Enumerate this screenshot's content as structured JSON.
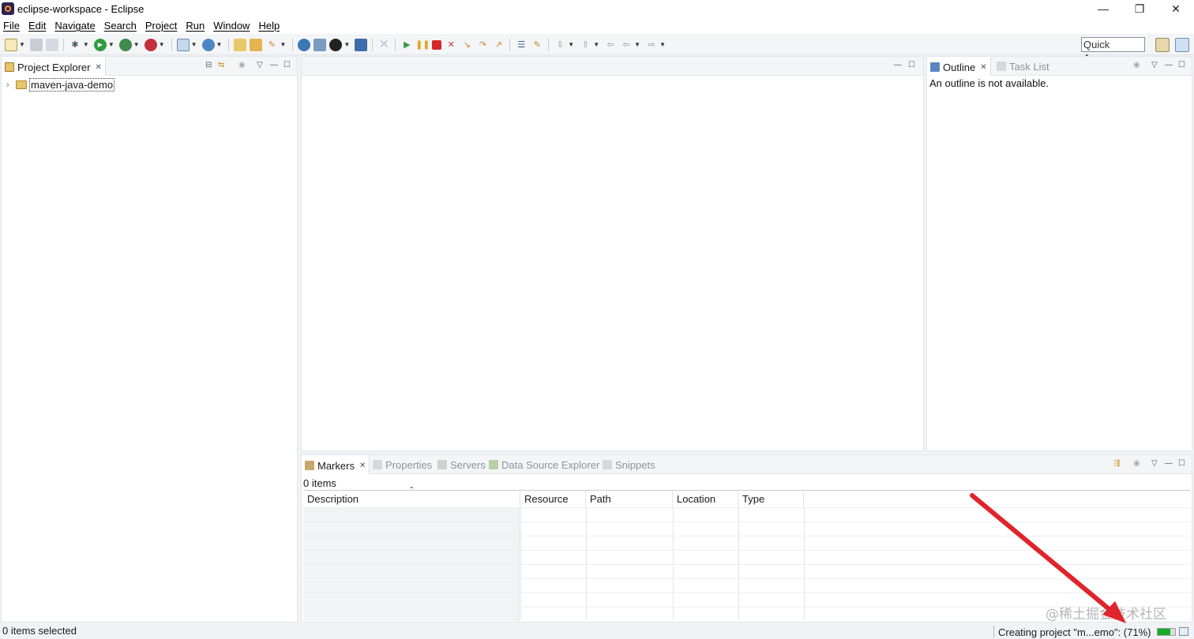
{
  "window": {
    "title": "eclipse-workspace - Eclipse",
    "controls": {
      "minimize": "—",
      "restore": "❐",
      "close": "✕"
    }
  },
  "menubar": [
    "File",
    "Edit",
    "Navigate",
    "Search",
    "Project",
    "Run",
    "Window",
    "Help"
  ],
  "toolbar": {
    "quick_access": "Quick Access"
  },
  "project_explorer": {
    "tab_label": "Project Explorer",
    "items": [
      {
        "label": "maven-java-demo",
        "icon": "project-folder-icon",
        "expanded": false
      }
    ]
  },
  "outline": {
    "tab_label": "Outline",
    "inactive_tab_label": "Task List",
    "message": "An outline is not available."
  },
  "bottom_panel": {
    "tabs": [
      {
        "label": "Markers",
        "active": true
      },
      {
        "label": "Properties",
        "active": false
      },
      {
        "label": "Servers",
        "active": false
      },
      {
        "label": "Data Source Explorer",
        "active": false
      },
      {
        "label": "Snippets",
        "active": false
      }
    ],
    "count_text": "0 items",
    "columns": [
      "Description",
      "Resource",
      "Path",
      "Location",
      "Type"
    ],
    "rows": []
  },
  "status": {
    "left": "0 items selected",
    "right": "Creating project \"m...emo\": (71%)",
    "progress_fraction": 0.71
  },
  "watermark": "@稀土掘金技术社区",
  "colors": {
    "progress_fill": "#1aaa2a",
    "annotation_arrow": "#e0242c"
  }
}
